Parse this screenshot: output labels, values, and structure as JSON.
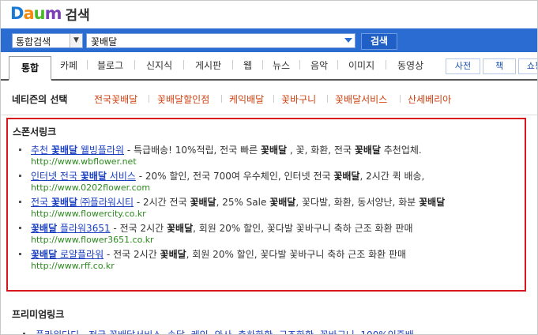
{
  "header": {
    "logo_text": "Daum",
    "logo_sub": "검색"
  },
  "search": {
    "scope_value": "통합검색",
    "query_value": "꽃배달",
    "button_label": "검색"
  },
  "tabs": {
    "active": "통합",
    "items": [
      "카페",
      "블로그",
      "신지식",
      "게시판",
      "웹",
      "뉴스",
      "음악",
      "이미지",
      "동영상"
    ],
    "boxes": [
      "사전",
      "책",
      "쇼핑"
    ]
  },
  "netizen": {
    "title": "네티즌의 선택",
    "items": [
      "전국꽃배달",
      "꽃배달할인점",
      "케익배달",
      "꽃바구니",
      "꽃배달서비스",
      "산세베리아"
    ]
  },
  "sponsor": {
    "title": "스폰서링크",
    "ads": [
      {
        "title_pre": "추천 ",
        "title_bold": "꽃배달",
        "title_post": " 웰빙플라워",
        "desc_parts": [
          " - 특급배송! 10%적립, 전국 빠른 ",
          "꽃배달",
          " , 꽃, 화환, 전국 ",
          "꽃배달",
          " 추천업체."
        ],
        "url": "http://www.wbflower.net"
      },
      {
        "title_pre": "인터넷 전국 ",
        "title_bold": "꽃배달",
        "title_post": " 서비스",
        "desc_parts": [
          " - 20% 할인, 전국 700여 우수체인, 인터넷 전국 ",
          "꽃배달",
          ", 2시간 퀵 배송,",
          "",
          ""
        ],
        "url": "http://www.0202flower.com"
      },
      {
        "title_pre": "전국 ",
        "title_bold": "꽃배달",
        "title_post": " ㈜플라워시티",
        "desc_parts": [
          " - 2시간 전국 ",
          "꽃배달",
          ", 25% Sale ",
          "꽃배달",
          ", 꽃다발, 화환, 동서양난, 화분 ",
          "꽃배달"
        ],
        "url": "http://www.flowercity.co.kr"
      },
      {
        "title_pre": "",
        "title_bold": "꽃배달",
        "title_post": " 플라워3651",
        "desc_parts": [
          " - 전국 2시간 ",
          "꽃배달",
          ", 회원 20% 할인, 꽃다발 꽃바구니 축하 근조 화환 판매",
          "",
          ""
        ],
        "url": "http://www.flower3651.co.kr"
      },
      {
        "title_pre": "",
        "title_bold": "꽃배달",
        "title_post": " 로얄플라워",
        "desc_parts": [
          " - 전국 2시간 ",
          "꽃배달",
          ", 회원 20% 할인, 꽃다발 꽃바구니 축하 근조 화환 판매",
          "",
          ""
        ],
        "url": "http://www.rff.co.kr"
      }
    ]
  },
  "premium": {
    "title": "프리미엄링크",
    "partial_text": "플라워다디 - 전국 꽃배달서비스, 속달, 케익, 와사, 축하화환, 근조화환, 꽃바구니, 100%인증배"
  },
  "colors": {
    "search_bar": "#2b6cd2",
    "sponsor_border": "#d9161b",
    "link_blue": "#1a3fc1",
    "url_green": "#2c8a1e",
    "netizen_orange": "#d04212"
  }
}
